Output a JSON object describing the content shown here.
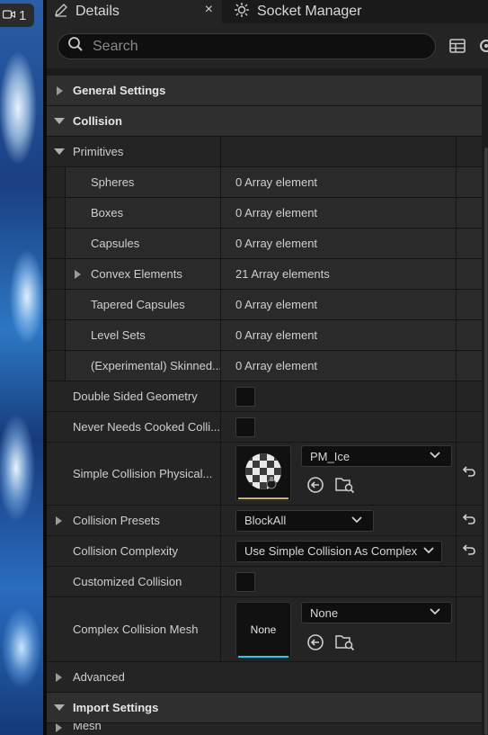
{
  "viewport": {
    "badge_number": "1"
  },
  "tabs": {
    "details_label": "Details",
    "close_glyph": "×",
    "socket_label": "Socket Manager"
  },
  "search": {
    "placeholder": "Search"
  },
  "categories": {
    "general": "General Settings",
    "collision": "Collision",
    "advanced": "Advanced",
    "import": "Import Settings",
    "partial_next": "Mesh"
  },
  "primitives": {
    "label": "Primitives",
    "items": [
      {
        "name": "Spheres",
        "value": "0 Array element"
      },
      {
        "name": "Boxes",
        "value": "0 Array element"
      },
      {
        "name": "Capsules",
        "value": "0 Array element"
      },
      {
        "name": "Convex Elements",
        "value": "21 Array elements"
      },
      {
        "name": "Tapered Capsules",
        "value": "0 Array element"
      },
      {
        "name": "Level Sets",
        "value": "0 Array element"
      },
      {
        "name": "(Experimental) Skinned...",
        "value": "0 Array element"
      }
    ]
  },
  "props": {
    "double_sided": "Double Sided Geometry",
    "never_cooked": "Never Needs Cooked Colli...",
    "simple_phys": "Simple Collision Physical...",
    "simple_phys_value": "PM_Ice",
    "presets": "Collision Presets",
    "presets_value": "BlockAll",
    "complexity": "Collision Complexity",
    "complexity_value": "Use Simple Collision As Complex",
    "customized": "Customized Collision",
    "complex_mesh": "Complex Collision Mesh",
    "complex_mesh_thumb": "None",
    "complex_mesh_value": "None"
  },
  "colors": {
    "panel": "#242424",
    "category": "#2f2f2f",
    "thumb_underline_yellow": "#c8b46a",
    "thumb_underline_cyan": "#2ec8e6"
  }
}
